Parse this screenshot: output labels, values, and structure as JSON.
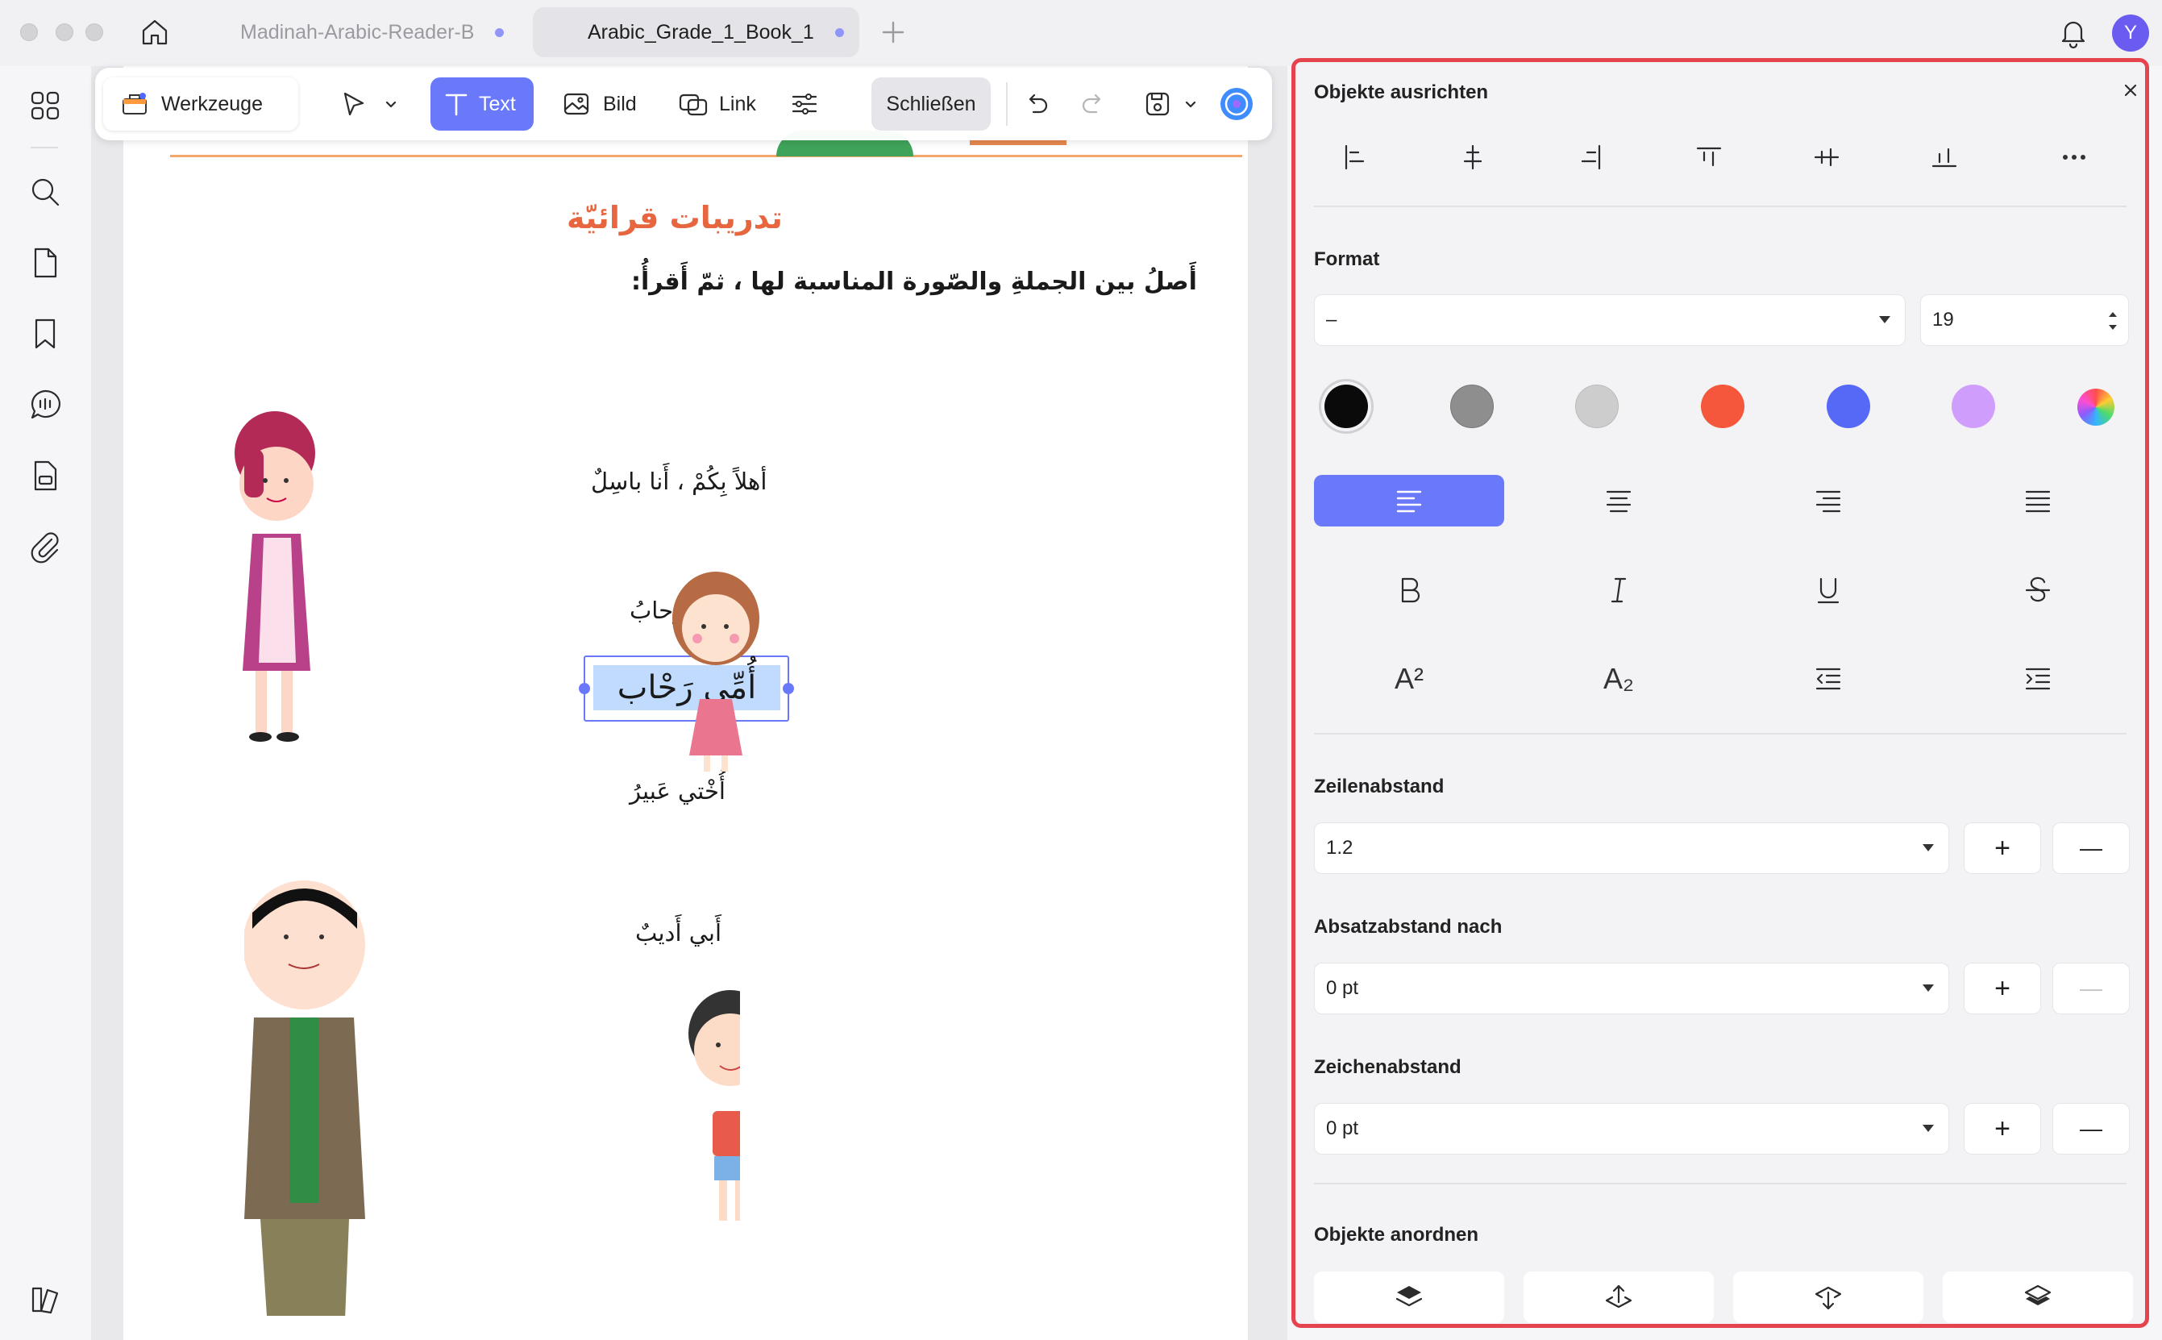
{
  "window": {
    "tabs": [
      {
        "label": "Madinah-Arabic-Reader-B",
        "active": false
      },
      {
        "label": "Arabic_Grade_1_Book_1",
        "active": true
      }
    ],
    "avatar_letter": "Y"
  },
  "toolbar": {
    "tools_label": "Werkzeuge",
    "text_label": "Text",
    "image_label": "Bild",
    "link_label": "Link",
    "close_label": "Schließen"
  },
  "document": {
    "heading": "تدريبات قرائيّة",
    "instruction": "أَصلُ بين الجملةِ والصّورة المناسبة لها ، ثمّ أَقرأُ:",
    "sentences": [
      "أهلاً بِكُمْ ، أَنا باسِلٌ",
      "أُمّي رِحابُ",
      "أُخْتي عَبيرُ",
      "أَبي أَديبٌ"
    ],
    "selected_text": "أُمِّي رَحْاب"
  },
  "panel": {
    "align_title": "Objekte ausrichten",
    "format_title": "Format",
    "font_value": "–",
    "font_size": "19",
    "colors": [
      "#0a0a0a",
      "#8e8e8e",
      "#cdcdcd",
      "#f5573c",
      "#5668f6",
      "#cf9dfb"
    ],
    "accent": "#6a79fa",
    "line_spacing_title": "Zeilenabstand",
    "line_spacing_value": "1.2",
    "para_spacing_title": "Absatzabstand nach",
    "para_spacing_value": "0 pt",
    "char_spacing_title": "Zeichenabstand",
    "char_spacing_value": "0 pt",
    "arrange_title": "Objekte anordnen",
    "superscript_label": "A²",
    "subscript_label": "A₂",
    "plus": "+",
    "minus": "—"
  }
}
